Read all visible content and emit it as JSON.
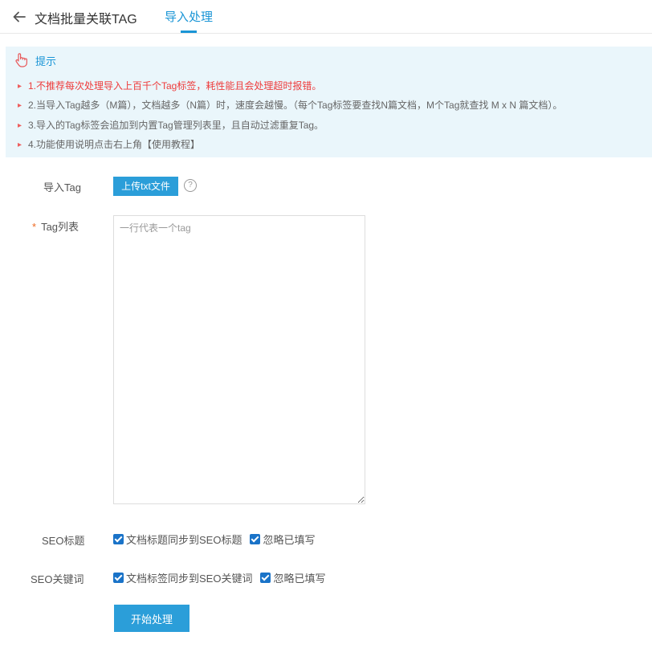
{
  "header": {
    "back_icon": "arrow-left-icon",
    "title": "文档批量关联TAG",
    "active_tab": "导入处理",
    "accent_color": "#1a95d6"
  },
  "tips": {
    "icon": "hand-pointer-icon",
    "title": "提示",
    "items": [
      "1.不推荐每次处理导入上百千个Tag标签，耗性能且会处理超时报错。",
      "2.当导入Tag越多（M篇），文档越多（N篇）时，速度会越慢。（每个Tag标签要查找N篇文档，M个Tag就查找 M x N 篇文档）。",
      "3.导入的Tag标签会追加到内置Tag管理列表里，且自动过滤重复Tag。",
      "4.功能使用说明点击右上角【使用教程】"
    ]
  },
  "form": {
    "import_tag_label": "导入Tag",
    "upload_button": "上传txt文件",
    "help_icon": "question-circle-icon",
    "tag_list_required": "*",
    "tag_list_label": "Tag列表",
    "tag_list_placeholder": "一行代表一个tag",
    "tag_list_value": "",
    "seo_title_label": "SEO标题",
    "seo_title_sync": "文档标题同步到SEO标题",
    "seo_title_sync_checked": true,
    "seo_title_ignore": "忽略已填写",
    "seo_title_ignore_checked": true,
    "seo_keywords_label": "SEO关键词",
    "seo_keywords_sync": "文档标签同步到SEO关键词",
    "seo_keywords_sync_checked": true,
    "seo_keywords_ignore": "忽略已填写",
    "seo_keywords_ignore_checked": true,
    "start_button": "开始处理"
  }
}
